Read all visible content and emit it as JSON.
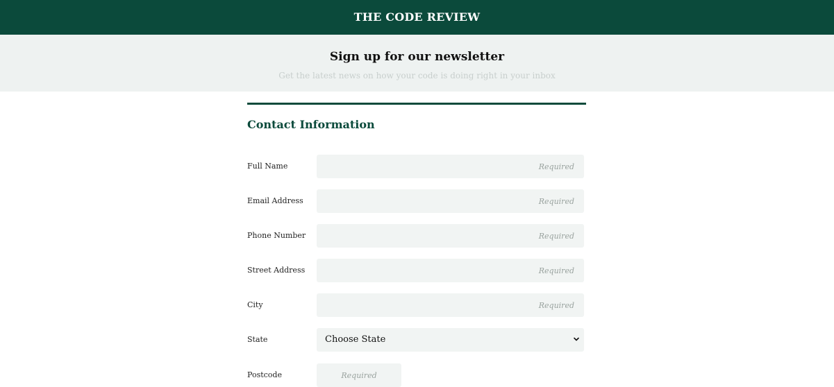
{
  "header": {
    "brand": "THE CODE REVIEW"
  },
  "banner": {
    "title": "Sign up for our newsletter",
    "subtitle": "Get the latest news on how your code is doing right in your inbox"
  },
  "form": {
    "section_title": "Contact Information",
    "fields": [
      {
        "label": "Full Name",
        "placeholder": "Required"
      },
      {
        "label": "Email Address",
        "placeholder": "Required"
      },
      {
        "label": "Phone Number",
        "placeholder": "Required"
      },
      {
        "label": "Street Address",
        "placeholder": "Required"
      },
      {
        "label": "City",
        "placeholder": "Required"
      },
      {
        "label": "State",
        "selected": "Choose State"
      },
      {
        "label": "Postcode",
        "placeholder": "Required"
      }
    ]
  },
  "icons": {
    "select_arrow": "chevron-down-icon"
  },
  "colors": {
    "brand": "#0b4a3b",
    "field_bg": "#f1f4f3",
    "banner_bg": "#eef2f1"
  }
}
